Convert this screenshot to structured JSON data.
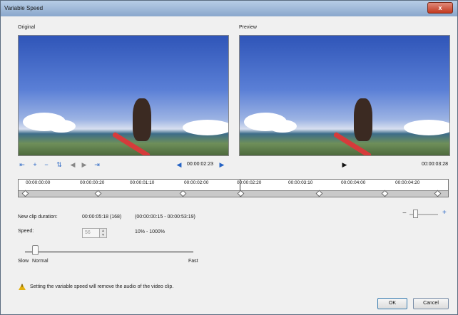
{
  "window": {
    "title": "Variable Speed",
    "close_label": "x"
  },
  "panels": {
    "original_label": "Original",
    "preview_label": "Preview"
  },
  "controls": {
    "current_time": "00:00:02:23",
    "preview_time": "00:00:03:28"
  },
  "timeline": {
    "ticks": [
      "00:00:00:00",
      "00:00:00:20",
      "00:00:01:10",
      "00:00:02:00",
      "00:00:02:20",
      "00:00:03:10",
      "00:00:04:00",
      "00:00:04:20"
    ]
  },
  "settings": {
    "new_clip_duration_label": "New clip duration:",
    "new_clip_duration_value": "00:00:05:18 (168)",
    "duration_range": "(00:00:00:15 - 00:00:53:19)",
    "speed_label": "Speed:",
    "speed_value": "56",
    "speed_range": "10% - 1000%",
    "slider_slow": "Slow",
    "slider_normal": "Normal",
    "slider_fast": "Fast"
  },
  "warning": {
    "text": "Setting the variable speed will remove the audio of the video clip."
  },
  "buttons": {
    "ok": "OK",
    "cancel": "Cancel"
  },
  "icons": {
    "zoom_out": "minus-icon",
    "zoom_in": "plus-icon",
    "warning": "warning-triangle-icon",
    "play": "play-icon"
  }
}
